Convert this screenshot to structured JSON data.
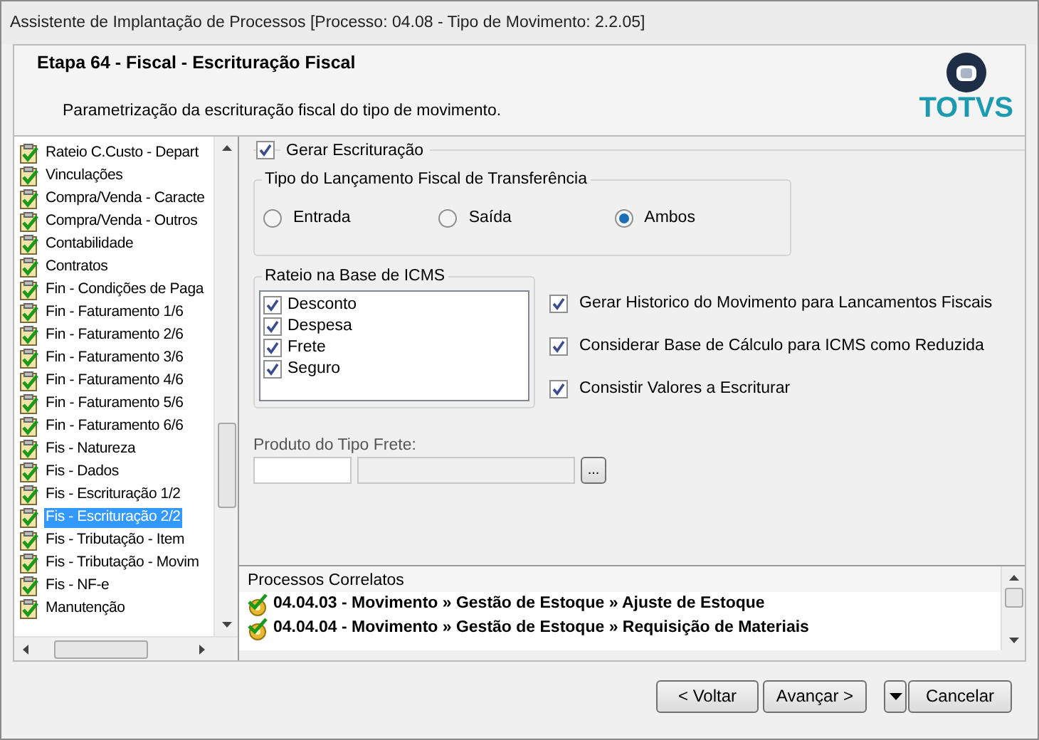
{
  "window": {
    "title": "Assistente de Implantação de Processos [Processo: 04.08 - Tipo de Movimento: 2.2.05]"
  },
  "header": {
    "title": "Etapa 64 - Fiscal - Escrituração Fiscal",
    "subtitle": "Parametrização da escrituração fiscal do tipo de movimento.",
    "logo": "TOTVS"
  },
  "steps": [
    {
      "label": "Rateio C.Custo - Depart",
      "selected": false
    },
    {
      "label": "Vinculações",
      "selected": false
    },
    {
      "label": "Compra/Venda - Caracte",
      "selected": false
    },
    {
      "label": "Compra/Venda - Outros",
      "selected": false
    },
    {
      "label": "Contabilidade",
      "selected": false
    },
    {
      "label": "Contratos",
      "selected": false
    },
    {
      "label": "Fin - Condições de Paga",
      "selected": false
    },
    {
      "label": "Fin - Faturamento 1/6",
      "selected": false
    },
    {
      "label": "Fin - Faturamento 2/6",
      "selected": false
    },
    {
      "label": "Fin - Faturamento 3/6",
      "selected": false
    },
    {
      "label": "Fin - Faturamento 4/6",
      "selected": false
    },
    {
      "label": "Fin - Faturamento 5/6",
      "selected": false
    },
    {
      "label": "Fin - Faturamento 6/6",
      "selected": false
    },
    {
      "label": "Fis - Natureza",
      "selected": false
    },
    {
      "label": "Fis - Dados",
      "selected": false
    },
    {
      "label": "Fis - Escrituração 1/2",
      "selected": false
    },
    {
      "label": "Fis - Escrituração 2/2",
      "selected": true
    },
    {
      "label": "Fis - Tributação - Item",
      "selected": false
    },
    {
      "label": "Fis - Tributação - Movim",
      "selected": false
    },
    {
      "label": "Fis - NF-e",
      "selected": false
    },
    {
      "label": "Manutenção",
      "selected": false
    }
  ],
  "gerar_escrituracao": {
    "label": "Gerar Escrituração",
    "checked": true
  },
  "tipo_lancamento": {
    "title": "Tipo do Lançamento Fiscal de Transferência",
    "options": [
      {
        "label": "Entrada",
        "selected": false
      },
      {
        "label": "Saída",
        "selected": false
      },
      {
        "label": "Ambos",
        "selected": true
      }
    ]
  },
  "rateio": {
    "title": "Rateio na Base de ICMS",
    "items": [
      {
        "label": "Desconto",
        "checked": true
      },
      {
        "label": "Despesa",
        "checked": true
      },
      {
        "label": "Frete",
        "checked": true
      },
      {
        "label": "Seguro",
        "checked": true
      }
    ]
  },
  "options": [
    {
      "label": "Gerar Historico do Movimento para Lancamentos Fiscais",
      "checked": true
    },
    {
      "label": "Considerar Base de Cálculo para ICMS como Reduzida",
      "checked": true
    },
    {
      "label": "Consistir Valores a Escriturar",
      "checked": true
    }
  ],
  "produto_frete": {
    "label": "Produto do Tipo Frete:",
    "browse_button": "..."
  },
  "related": {
    "title": "Processos Correlatos",
    "items": [
      {
        "text": "04.04.03 - Movimento » Gestão de Estoque » Ajuste de Estoque"
      },
      {
        "text": "04.04.04 - Movimento » Gestão de Estoque » Requisição de Materiais"
      }
    ]
  },
  "buttons": [
    {
      "kind": "button",
      "label": "< Voltar"
    },
    {
      "kind": "button",
      "label": "Avançar >"
    },
    {
      "kind": "dropdown"
    },
    {
      "kind": "button",
      "label": "Cancelar"
    }
  ]
}
